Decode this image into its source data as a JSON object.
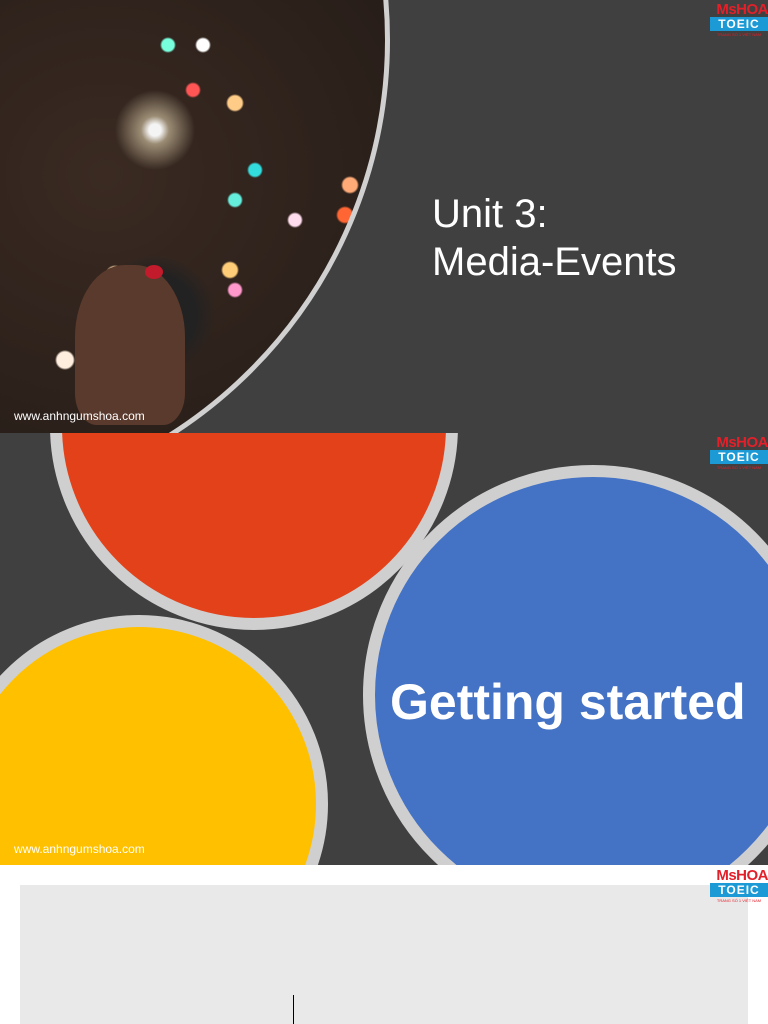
{
  "slides": [
    {
      "title_line1": "Unit 3:",
      "title_line2": "Media-Events",
      "url": "www.anhngumshoa.com"
    },
    {
      "title": "Getting started",
      "url": "www.anhngumshoa.com"
    },
    {}
  ],
  "logo": {
    "brand": "MsHOA",
    "product": "TOEIC",
    "tagline": "TRANG SỐ 1 VIỆT NAM"
  },
  "colors": {
    "background": "#404040",
    "red": "#e2411a",
    "yellow": "#ffc000",
    "blue": "#4472c4"
  }
}
